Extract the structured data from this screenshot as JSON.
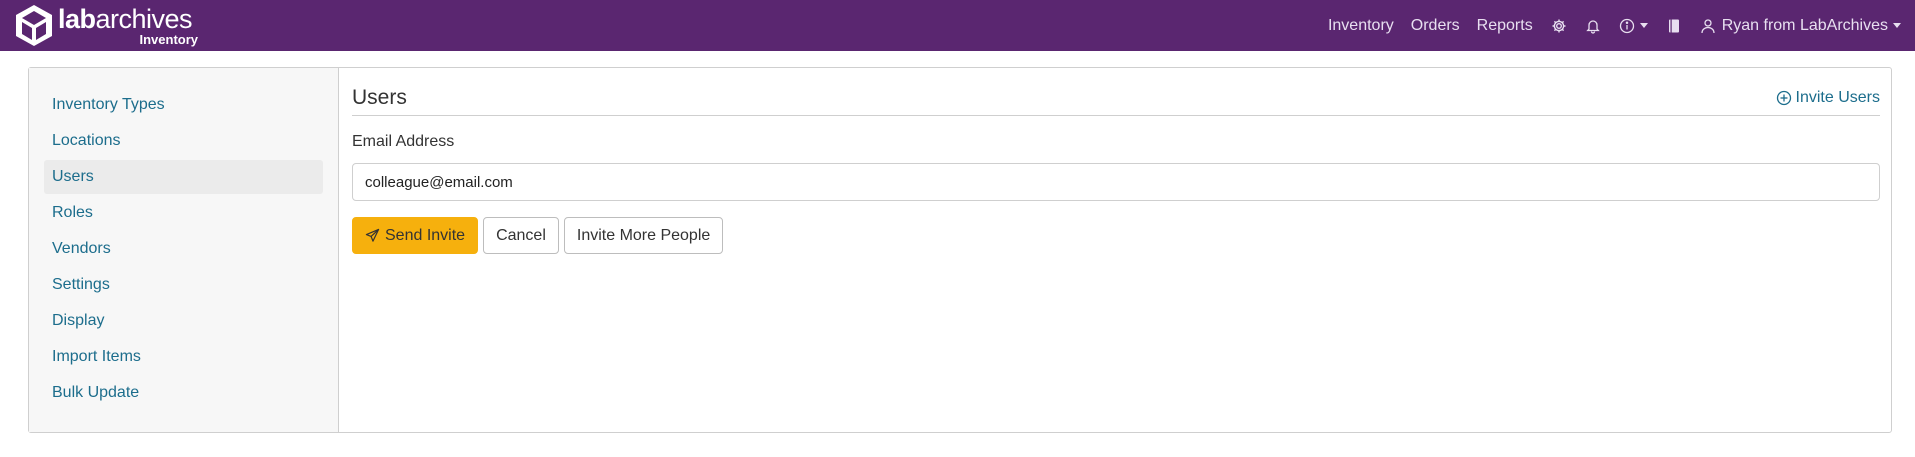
{
  "brand": {
    "name_bold": "lab",
    "name_regular": "archives",
    "sub": "Inventory",
    "logo_icon": "labarchives-cube-logo"
  },
  "nav": {
    "links": [
      "Inventory",
      "Orders",
      "Reports"
    ],
    "icons": [
      "gear-icon",
      "bell-icon",
      "info-icon",
      "notebook-icon"
    ],
    "user": "Ryan from LabArchives"
  },
  "sidebar": {
    "items": [
      {
        "label": "Inventory Types"
      },
      {
        "label": "Locations"
      },
      {
        "label": "Users",
        "active": true
      },
      {
        "label": "Roles"
      },
      {
        "label": "Vendors"
      },
      {
        "label": "Settings"
      },
      {
        "label": "Display"
      },
      {
        "label": "Import Items"
      },
      {
        "label": "Bulk Update"
      }
    ]
  },
  "main": {
    "title": "Users",
    "invite_link": "Invite Users",
    "email_label": "Email Address",
    "email_value": "colleague@email.com",
    "buttons": {
      "send": "Send Invite",
      "cancel": "Cancel",
      "invite_more": "Invite More People"
    }
  },
  "colors": {
    "navbar": "#5a2670",
    "link": "#1c6d8c",
    "primary_button": "#f6b00d"
  }
}
